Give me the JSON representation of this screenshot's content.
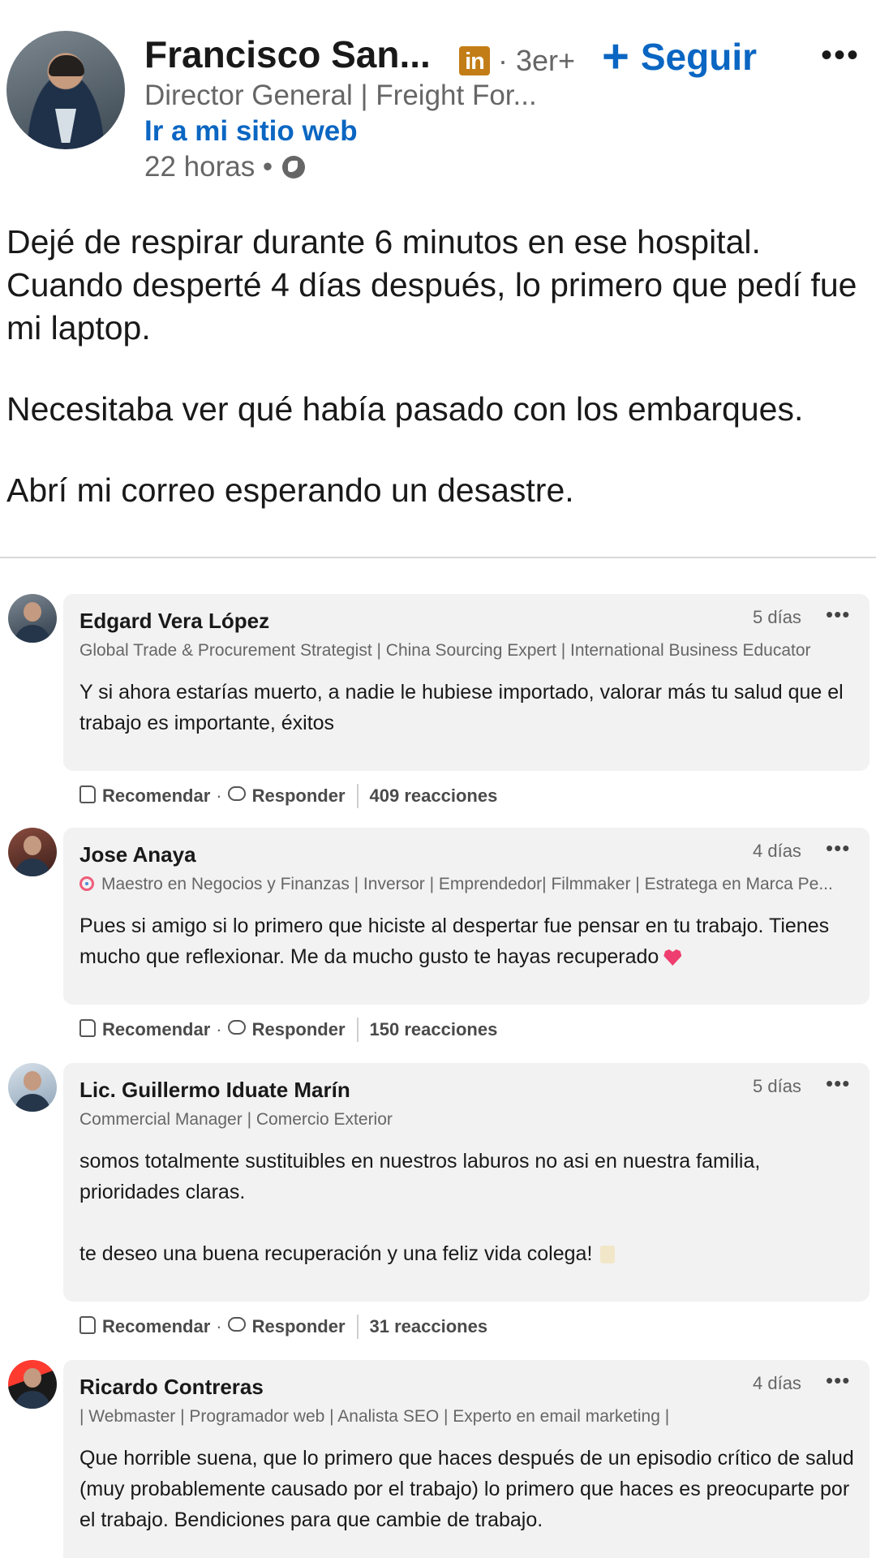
{
  "post": {
    "author_name": "Francisco San...",
    "badge": "in",
    "degree": "· 3er+",
    "follow_plus": "+",
    "follow_label": "Seguir",
    "more": "•••",
    "headline": "Director General | Freight For...",
    "site_link": "Ir a mi sitio web",
    "time": "22 horas •",
    "globe_icon": "globe-icon",
    "body": [
      "Dejé de respirar durante 6 minutos en ese hospital.",
      "Cuando desperté 4 días después, lo primero que pedí fue mi laptop.",
      "Necesitaba ver qué había pasado con los embarques.",
      "Abrí mi correo esperando un desastre."
    ]
  },
  "colors": {
    "link_blue": "#0a66c2",
    "badge_gold": "#c37d16",
    "bubble_gray": "#f2f2f2",
    "heart_pink": "#ee3e6f"
  },
  "comments": [
    {
      "name": "Edgard Vera López",
      "time": "5 días",
      "more": "•••",
      "headline": "Global Trade & Procurement Strategist | China Sourcing Expert | International Business Educator",
      "text": [
        "Y si ahora estarías muerto, a nadie le hubiese importado, valorar más tu salud que el trabajo es importante, éxitos"
      ],
      "recommend": "Recomendar",
      "reply": "Responder",
      "reactions": "409 reacciones"
    },
    {
      "name": "Jose Anaya",
      "time": "4 días",
      "more": "•••",
      "headline": "Maestro en Negocios y Finanzas | Inversor | Emprendedor| Filmmaker | Estratega en Marca Pe...",
      "text": [
        "Pues si amigo si lo primero que hiciste al despertar fue pensar en tu trabajo. Tienes mucho que reflexionar. Me da mucho gusto te hayas recuperado"
      ],
      "recommend": "Recomendar",
      "reply": "Responder",
      "reactions": "150 reacciones"
    },
    {
      "name": "Lic. Guillermo Iduate Marín",
      "time": "5 días",
      "more": "•••",
      "headline": "Commercial Manager | Comercio Exterior",
      "text": [
        "somos totalmente sustituibles en nuestros laburos no asi en nuestra familia, prioridades claras.",
        "te deseo una buena recuperación y una feliz vida colega!"
      ],
      "recommend": "Recomendar",
      "reply": "Responder",
      "reactions": "31 reacciones"
    },
    {
      "name": "Ricardo Contreras",
      "time": "4 días",
      "more": "•••",
      "headline": "| Webmaster | Programador web | Analista SEO | Experto en email marketing |",
      "text": [
        "Que horrible suena, que lo primero que haces después de un episodio crítico de salud (muy probablemente causado por el trabajo) lo primero que haces es preocuparte por el trabajo. Bendiciones para que cambie de trabajo."
      ]
    }
  ]
}
